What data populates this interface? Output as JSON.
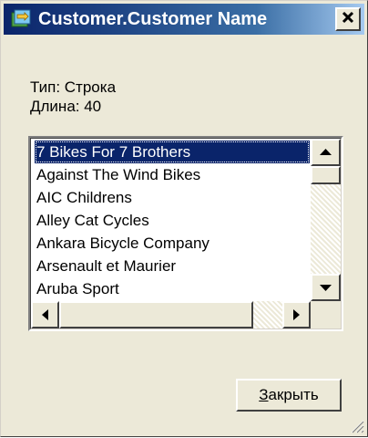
{
  "window": {
    "title": "Customer.Customer Name",
    "close_glyph": "✕",
    "title_icon": "table-field-icon"
  },
  "info": {
    "type_line": "Тип: Строка",
    "length_line": "Длина: 40"
  },
  "list": {
    "items": [
      "7 Bikes For 7 Brothers",
      "Against The Wind Bikes",
      "AIC Childrens",
      "Alley Cat Cycles",
      "Ankara Bicycle Company",
      "Arsenault et Maurier",
      "Aruba Sport"
    ],
    "selected_index": 0
  },
  "buttons": {
    "close_accel": "З",
    "close_rest": "акрыть"
  },
  "colors": {
    "selection": "#0a246a",
    "face": "#ece9d8"
  }
}
